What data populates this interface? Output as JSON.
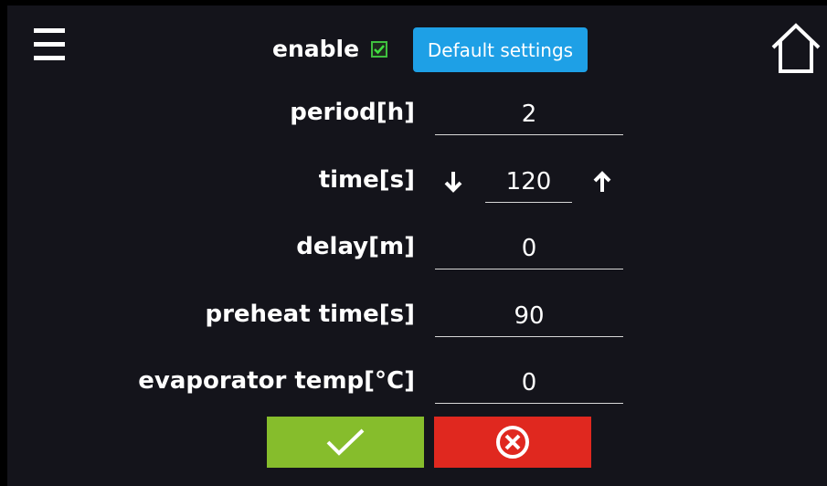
{
  "header": {
    "enable_label": "enable",
    "enable_checked": true,
    "default_settings_label": "Default settings",
    "menu_icon": "hamburger-menu-icon",
    "home_icon": "home-icon"
  },
  "fields": {
    "period": {
      "label": "period[h]",
      "value": "2"
    },
    "time": {
      "label": "time[s]",
      "value": "120"
    },
    "delay": {
      "label": "delay[m]",
      "value": "0"
    },
    "preheat": {
      "label": "preheat time[s]",
      "value": "90"
    },
    "evaporator": {
      "label": "evaporator temp[°C]",
      "value": "0"
    }
  },
  "actions": {
    "confirm_icon": "checkmark-icon",
    "cancel_icon": "circle-x-icon"
  },
  "colors": {
    "background": "#14141b",
    "accent_blue": "#1ea0e6",
    "confirm_green": "#86bd2c",
    "cancel_red": "#e0281f"
  }
}
